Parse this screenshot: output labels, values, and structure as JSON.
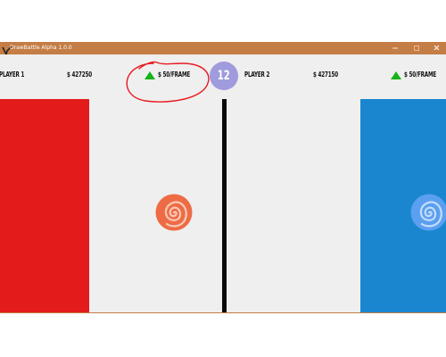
{
  "window": {
    "title": "DrawBattle Alpha 1.0.0",
    "titlebar_color": "#c47d45",
    "buttons": {
      "minimize_icon": "minimize-icon",
      "maximize_icon": "maximize-icon",
      "close_icon": "close-icon"
    }
  },
  "hud": {
    "player1": {
      "label": "PLAYER 1",
      "money": "$ 427250",
      "rate": "$ 50/FRAME",
      "rate_icon": "green-up-triangle-icon",
      "color": "#e31b1b"
    },
    "player2": {
      "label": "PLAYER 2",
      "money": "$ 427150",
      "rate": "$ 50/FRAME",
      "rate_icon": "green-up-triangle-icon",
      "color": "#1a86d0"
    },
    "timer": {
      "value": "12",
      "color": "#9f9bdc"
    }
  },
  "field": {
    "background_color": "#efefef",
    "divider_color": "#0a0a0a",
    "player1_ball": {
      "icon": "orange-spiral-icon",
      "color": "#ee6c45"
    },
    "player2_ball": {
      "icon": "blue-spiral-icon",
      "color": "#5b9ff0"
    }
  },
  "annotation": {
    "type": "red-hand-drawn-circle",
    "color": "#e8191f"
  }
}
